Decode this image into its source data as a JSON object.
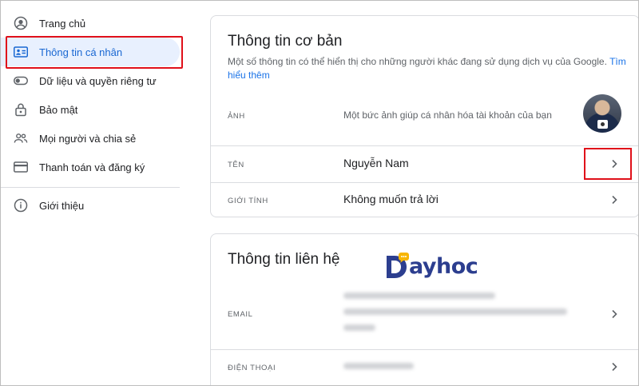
{
  "sidebar": {
    "items": [
      {
        "label": "Trang chủ",
        "icon": "account-circle-icon"
      },
      {
        "label": "Thông tin cá nhân",
        "icon": "id-card-icon",
        "active": true
      },
      {
        "label": "Dữ liệu và quyền riêng tư",
        "icon": "toggle-icon"
      },
      {
        "label": "Bảo mật",
        "icon": "lock-icon"
      },
      {
        "label": "Mọi người và chia sẻ",
        "icon": "people-icon"
      },
      {
        "label": "Thanh toán và đăng ký",
        "icon": "credit-card-icon"
      }
    ],
    "footer_item": {
      "label": "Giới thiệu",
      "icon": "info-icon"
    }
  },
  "basic_info": {
    "title": "Thông tin cơ bản",
    "desc": "Một số thông tin có thể hiển thị cho những người khác đang sử dụng dịch vụ của Google.",
    "learn_more": "Tìm hiểu thêm",
    "photo": {
      "key": "ẢNH",
      "desc": "Một bức ảnh giúp cá nhân hóa tài khoản của bạn"
    },
    "name": {
      "key": "TÊN",
      "value": "Nguyễn Nam"
    },
    "gender": {
      "key": "GIỚI TÍNH",
      "value": "Không muốn trả lời"
    }
  },
  "contact_info": {
    "title": "Thông tin liên hệ",
    "email": {
      "key": "EMAIL"
    },
    "phone": {
      "key": "ĐIỆN THOẠI"
    }
  },
  "watermark": {
    "text": "ayhoc"
  },
  "colors": {
    "highlight": "#e0101a",
    "accent": "#1a73e8",
    "active_bg": "#e8f0fe",
    "logo": "#2c3e8f",
    "logo_bubble": "#f7b500"
  }
}
